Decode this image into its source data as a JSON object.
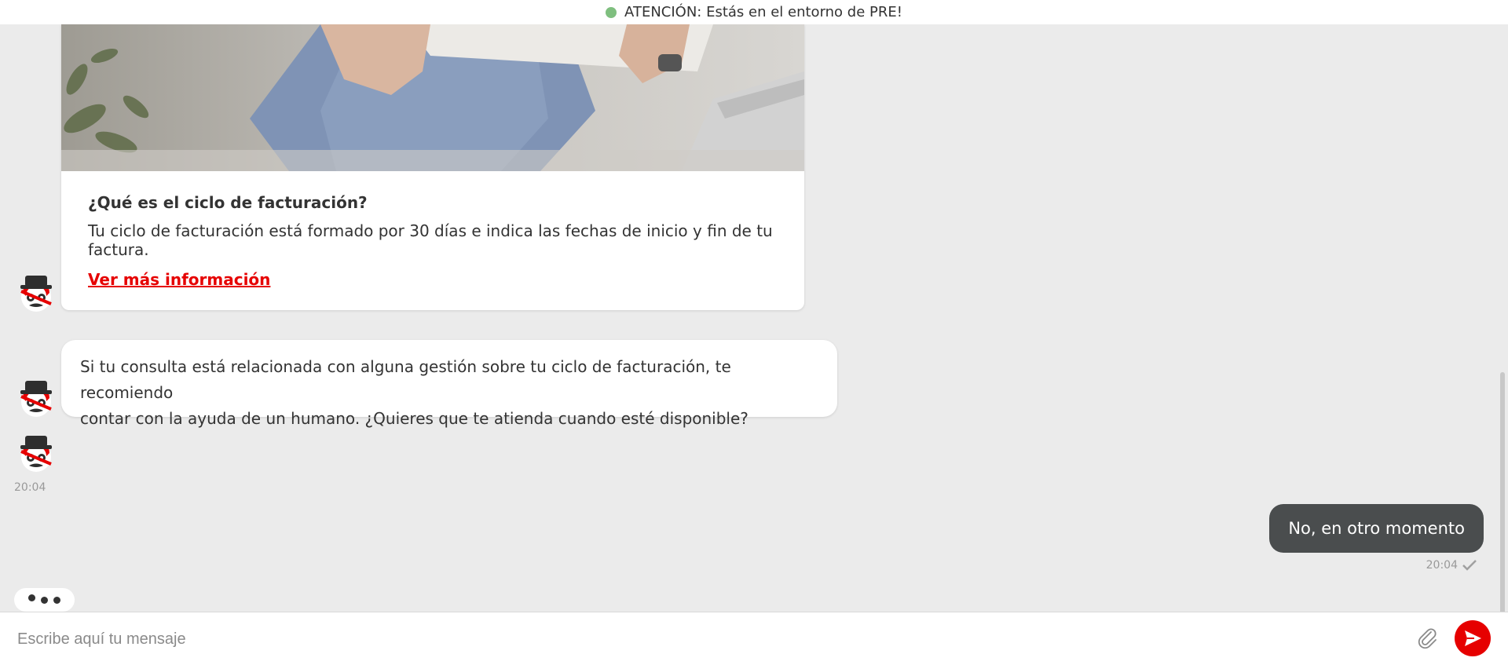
{
  "banner": {
    "text": "ATENCIÓN: Estás en el entorno de PRE!",
    "status_color": "#7fbf7f"
  },
  "card": {
    "image_icon": "person-reading-bill-photo",
    "title": "¿Qué es el ciclo de facturación?",
    "text": "Tu ciclo de facturación está formado por 30 días e indica las fechas de inicio y fin de tu factura.",
    "link_label": "Ver más información",
    "link_color": "#e60000"
  },
  "bot_message": {
    "line1": "Si tu consulta está relacionada con alguna gestión sobre tu ciclo de facturación, te recomiendo",
    "line2": "contar con la ayuda de un humano. ¿Quieres que te atienda cuando esté disponible?",
    "time": "20:04"
  },
  "user_message": {
    "text": "No, en otro momento",
    "time": "20:04",
    "status_icon": "checkmark-icon"
  },
  "avatar_icon": "bot-avatar-icon",
  "typing_icon": "typing-indicator",
  "input": {
    "placeholder": "Escribe aquí tu mensaje",
    "value": ""
  },
  "icons": {
    "attach": "paperclip-icon",
    "send": "send-icon"
  },
  "colors": {
    "background": "#ebebeb",
    "accent": "#e60000",
    "user_bubble": "#4a4d4e"
  }
}
